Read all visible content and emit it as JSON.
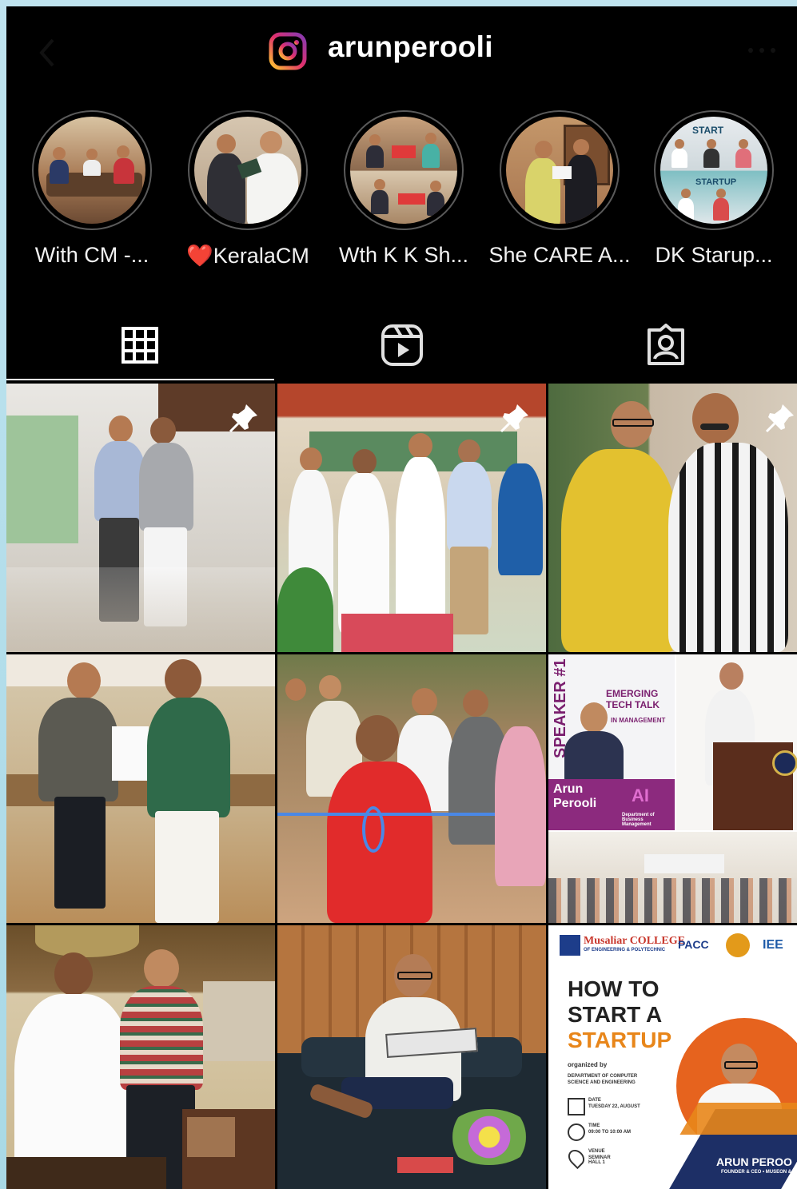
{
  "header": {
    "username": "arunperooli",
    "back_icon": "chevron-left-icon",
    "logo_icon": "instagram-icon",
    "menu_icon": "more-icon"
  },
  "highlights": [
    {
      "label": "With CM -..."
    },
    {
      "label": "❤️KeralaCM"
    },
    {
      "label": "Wth K K Sh..."
    },
    {
      "label": "She CARE A..."
    },
    {
      "label": "DK Starup..."
    }
  ],
  "tabs": [
    {
      "icon": "grid-icon",
      "active": true
    },
    {
      "icon": "reels-icon",
      "active": false
    },
    {
      "icon": "tagged-icon",
      "active": false
    }
  ],
  "posts": {
    "p6": {
      "speaker": "SPEAKER #1",
      "title": "EMERGING TECH TALK",
      "subtitle": "IN MANAGEMENT",
      "name_line1": "Arun",
      "name_line2": "Perooli",
      "ai": "AI",
      "dept": "Department of Business Management"
    },
    "p9": {
      "college": "Musaliar COLLEGE",
      "college_sub": "OF ENGINEERING & POLYTECHNIC",
      "pacc": "PACC",
      "ieee": "IEE",
      "title_line1": "HOW TO",
      "title_line2": "START A",
      "title_line3": "STARTUP",
      "organized_by": "organized by",
      "dept_line1": "DEPARTMENT OF COMPUTER",
      "dept_line2": "SCIENCE AND ENGINEERING",
      "date_label": "DATE",
      "date_value": "TUESDAY 22, AUGUST",
      "time_label": "TIME",
      "time_value": "09:00 TO 10:00 AM",
      "venue_label": "VENUE",
      "venue_value": "SEMINAR HALL 1",
      "speaker_name": "ARUN PEROO",
      "speaker_role": "FOUNDER & CEO • MUSEON &"
    }
  }
}
